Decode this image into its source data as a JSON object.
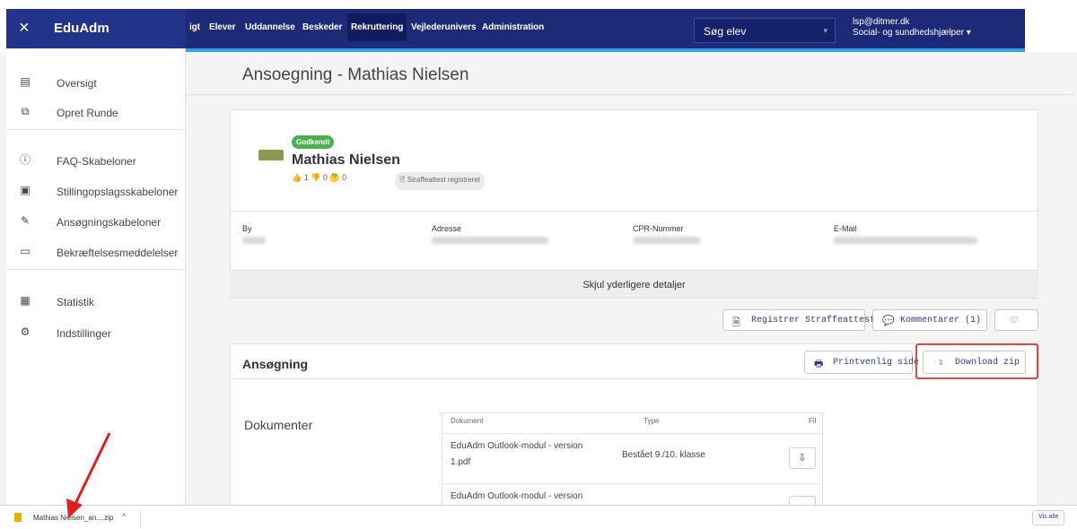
{
  "app": {
    "brand": "EduAdm",
    "close_icon": "×"
  },
  "nav": {
    "items": [
      "igt",
      "Elever",
      "Uddannelse",
      "Beskeder",
      "Rekruttering",
      "Vejlederunivers",
      "Administration"
    ],
    "active": "Rekruttering",
    "search_label": "Søg elev",
    "search_caret": "▾",
    "user_email": "lsp@ditmer.dk",
    "user_role": "Social- og sundhedshjælper ▾"
  },
  "sidebar": {
    "items": [
      {
        "label": "Oversigt",
        "icon": "▤"
      },
      {
        "label": "Opret Runde",
        "icon": "⧉"
      },
      {
        "label": "FAQ-Skabeloner",
        "icon": "ⓘ"
      },
      {
        "label": "Stillingopslagsskabeloner",
        "icon": "▣"
      },
      {
        "label": "Ansøgningskabeloner",
        "icon": "✎"
      },
      {
        "label": "Bekræftelsesmeddelelser",
        "icon": "▭"
      },
      {
        "label": "Statistik",
        "icon": "▦"
      },
      {
        "label": "Indstillinger",
        "icon": "⚙"
      }
    ]
  },
  "page": {
    "title": "Ansoegning - Mathias Nielsen"
  },
  "candidate": {
    "status_badge": "Godkendt",
    "name": "Mathias Nielsen",
    "votes": "👍 1    👎 0    🤔 0",
    "chip": "🗎 Straffeattest registreret"
  },
  "details": {
    "labels": [
      "By",
      "Adresse",
      "CPR-Nummer",
      "E-Mail"
    ],
    "toggle_label": "Skjul yderligere detaljer"
  },
  "actions": {
    "register_icon": "🗎",
    "register_label": "Registrer Straffeattest",
    "comments_icon": "💬",
    "comments_label": "Kommentarer (1)",
    "favorite_icon": "♡",
    "print_icon": "🖶",
    "print_label": "Printvenlig side",
    "download_icon": "⇩",
    "download_label": "Download zip"
  },
  "application": {
    "section_title": "Ansøgning",
    "docs_heading": "Dokumenter",
    "table_headers": [
      "Dokument",
      "Type",
      "Fil"
    ],
    "rows": [
      {
        "name_line1": "EduAdm Outlook-modul - version",
        "name_line2": "1.pdf",
        "type": "Bestået 9./10. klasse",
        "file_icon": "⇩"
      },
      {
        "name_line1": "EduAdm Outlook-modul - version",
        "name_line2": "",
        "type": "",
        "file_icon": ""
      }
    ]
  },
  "downloads": {
    "filename": "Mathias Nielsen_an....zip",
    "chevron": "^",
    "show_all": "Vis alle"
  }
}
